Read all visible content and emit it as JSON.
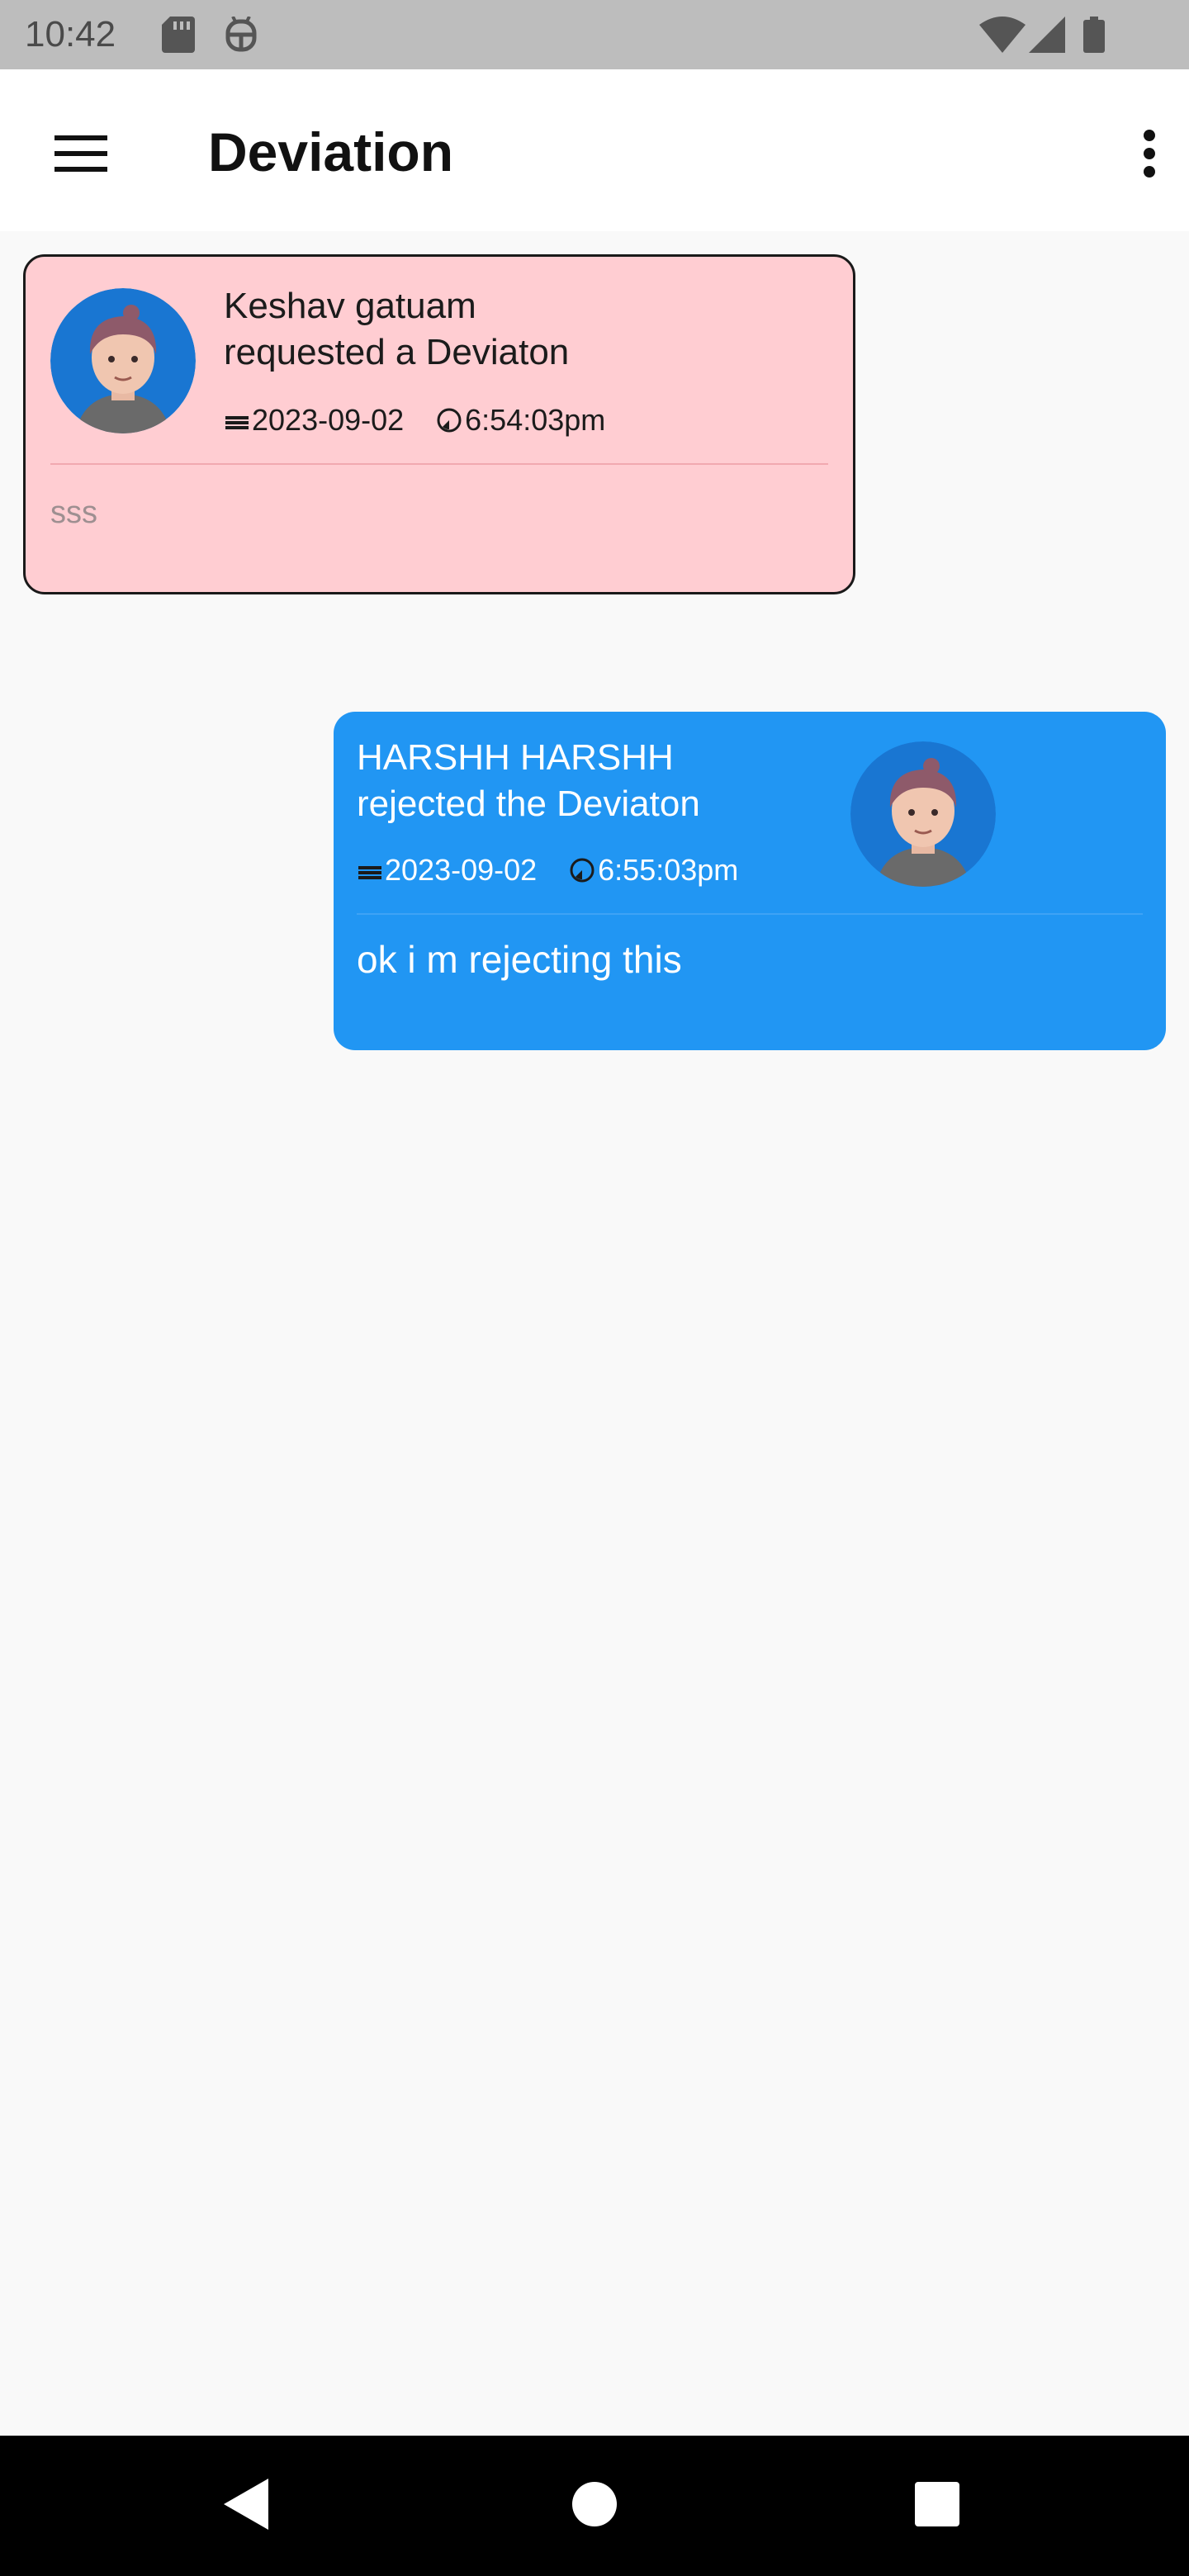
{
  "status_bar": {
    "time": "10:42",
    "icons": [
      "sd-card-icon",
      "android-debug-icon",
      "wifi-icon",
      "signal-icon",
      "battery-icon"
    ]
  },
  "app_bar": {
    "title": "Deviation",
    "menu_icon": "hamburger-menu-icon",
    "more_icon": "more-vertical-icon"
  },
  "colors": {
    "incoming_card_bg": "#ffcdd2",
    "outgoing_card_bg": "#2196f3",
    "avatar_bg": "#1976d2"
  },
  "messages": [
    {
      "line1": "Keshav gatuam",
      "line2": "requested a Deviaton",
      "date": "2023-09-02",
      "time": "6:54:03pm",
      "text": "sss"
    },
    {
      "line1": "HARSHH HARSHH",
      "line2": "rejected the Deviaton",
      "date": "2023-09-02",
      "time": "6:55:03pm",
      "text": "ok i m rejecting this"
    }
  ],
  "nav_bar": {
    "back_icon": "back-triangle-icon",
    "home_icon": "home-circle-icon",
    "recents_icon": "recents-square-icon"
  }
}
